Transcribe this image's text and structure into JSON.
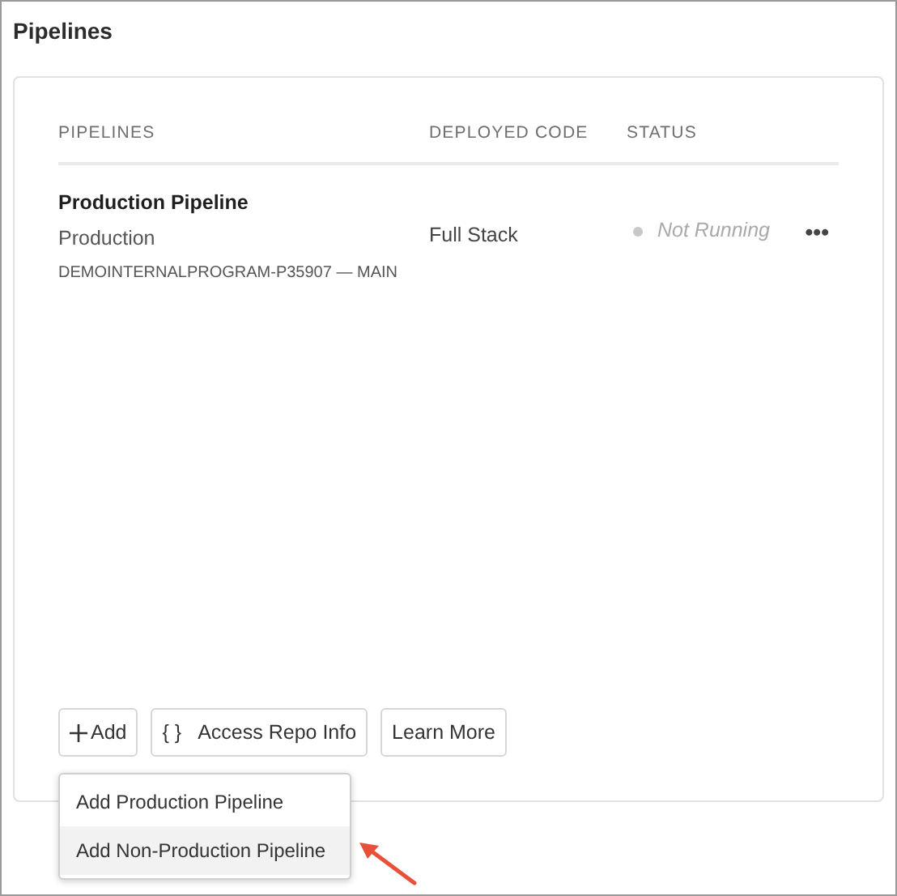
{
  "title": "Pipelines",
  "table": {
    "columns": [
      "PIPELINES",
      "DEPLOYED CODE",
      "STATUS"
    ],
    "rows": [
      {
        "name": "Production Pipeline",
        "type": "Production",
        "repo": "DEMOINTERNALPROGRAM-P35907 — MAIN",
        "deployed_code": "Full Stack",
        "status": "Not Running",
        "color": "#c8c8c8",
        "more": "•••"
      }
    ]
  },
  "buttons": [
    {
      "kind": "add",
      "label": "Add"
    },
    {
      "kind": "repo",
      "icon": "{ }",
      "label": "Access Repo Info"
    },
    {
      "kind": "plain",
      "label": "Learn More"
    }
  ],
  "menu": {
    "items": [
      {
        "label": "Add Production Pipeline",
        "selected": false
      },
      {
        "label": "Add Non-Production Pipeline",
        "selected": true
      }
    ]
  }
}
